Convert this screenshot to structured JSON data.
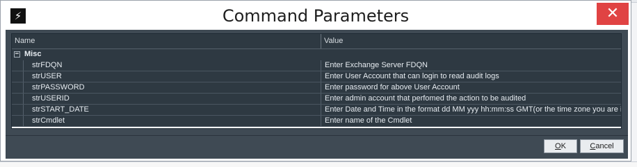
{
  "window": {
    "title": "Command Parameters",
    "close_glyph": "✕",
    "icon": "app-logo-icon"
  },
  "grid": {
    "columns": [
      "Name",
      "Value"
    ],
    "group": {
      "expander": "−",
      "label": "Misc"
    },
    "rows": [
      {
        "name": "strFDQN",
        "value": "Enter Exchange Server FDQN"
      },
      {
        "name": "strUSER",
        "value": "Enter User Account that can login to read audit logs"
      },
      {
        "name": "strPASSWORD",
        "value": "Enter password for above User Account"
      },
      {
        "name": "strUSERID",
        "value": "Enter admin account that perfomed the action to be audited"
      },
      {
        "name": "strSTART_DATE",
        "value": "Enter Date and Time in the format dd MM yyy hh:mm:ss GMT(or the time zone you are in)"
      },
      {
        "name": "strCmdlet",
        "value": "Enter name of the Cmdlet"
      }
    ]
  },
  "buttons": {
    "ok_mnemonic": "O",
    "ok_rest": "K",
    "cancel_mnemonic": "C",
    "cancel_rest": "ancel"
  },
  "colors": {
    "panel": "#3f4a54",
    "close_button": "#e04343",
    "grid_row": "#2e3942"
  }
}
